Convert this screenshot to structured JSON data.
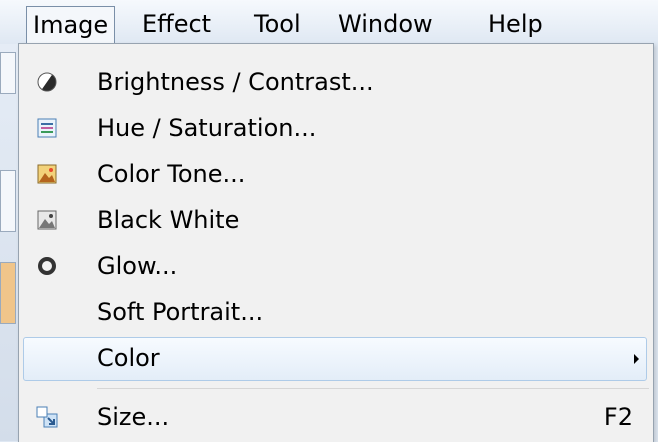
{
  "menubar": {
    "items": [
      "Image",
      "Effect",
      "Tool",
      "Window",
      "Help"
    ]
  },
  "menu": {
    "items": [
      {
        "label": "Brightness / Contrast...",
        "icon": "brightness-contrast-icon"
      },
      {
        "label": "Hue / Saturation...",
        "icon": "hue-saturation-icon"
      },
      {
        "label": "Color Tone...",
        "icon": "color-tone-icon"
      },
      {
        "label": "Black White",
        "icon": "black-white-icon"
      },
      {
        "label": "Glow...",
        "icon": "glow-icon"
      },
      {
        "label": "Soft Portrait..."
      },
      {
        "label": "Color",
        "submenu": true
      },
      {
        "label": "Size...",
        "icon": "resize-icon",
        "shortcut": "F2"
      }
    ]
  }
}
